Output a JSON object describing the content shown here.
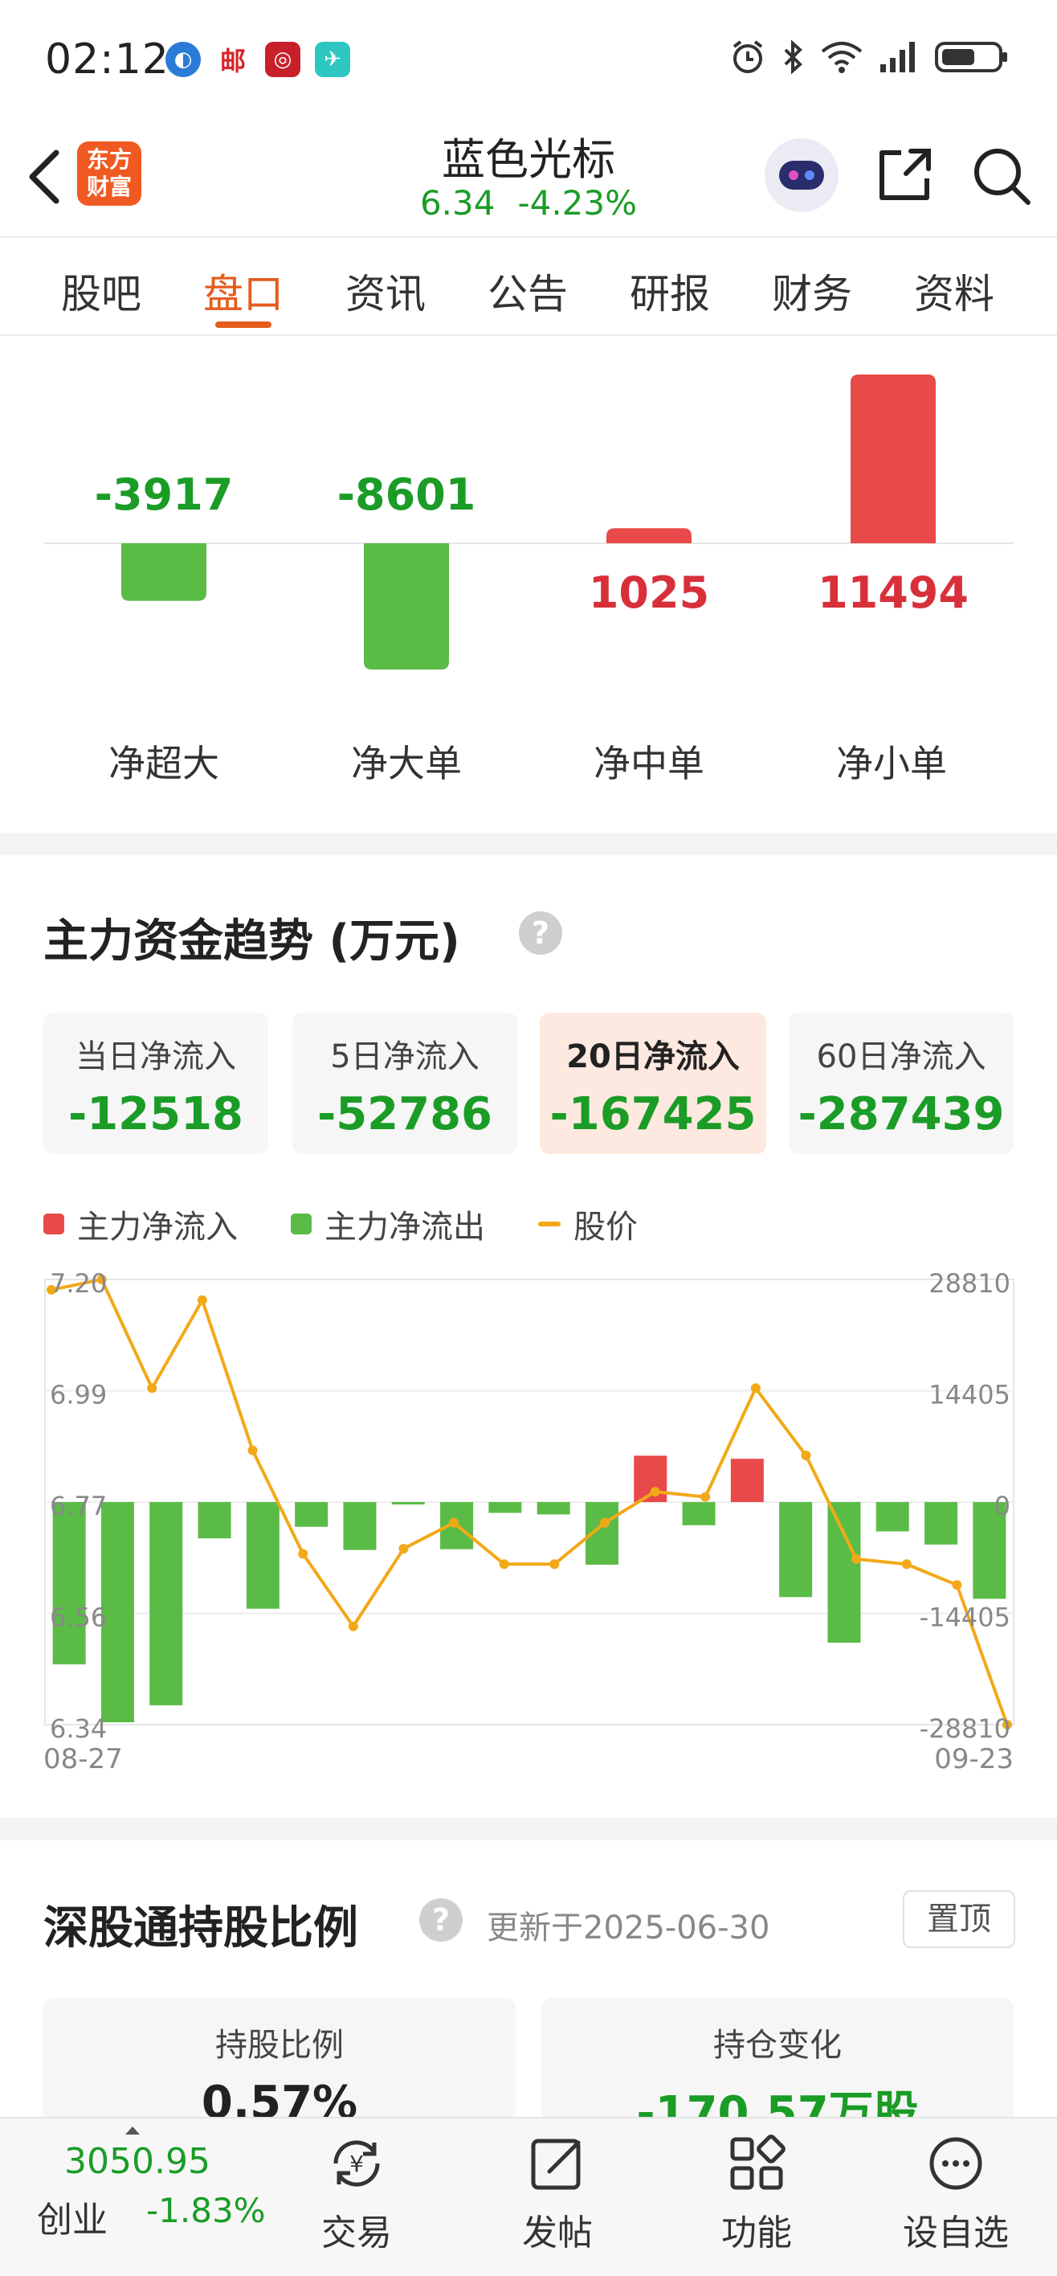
{
  "status_bar": {
    "time": "02:12"
  },
  "header": {
    "logo_text_top": "东方",
    "logo_text_bottom": "财富",
    "stock_name": "蓝色光标",
    "price": "6.34",
    "change_pct": "-4.23%"
  },
  "tabs": [
    "股吧",
    "盘口",
    "资讯",
    "公告",
    "研报",
    "财务",
    "资料"
  ],
  "active_tab": "盘口",
  "flow_bars": {
    "items": [
      {
        "label": "净超大",
        "value": -3917,
        "display": "-3917"
      },
      {
        "label": "净大单",
        "value": -8601,
        "display": "-8601"
      },
      {
        "label": "净中单",
        "value": 1025,
        "display": "1025"
      },
      {
        "label": "净小单",
        "value": 11494,
        "display": "11494"
      }
    ]
  },
  "trend": {
    "title": "主力资金趋势 (万元)",
    "help": "?",
    "cards": [
      {
        "label": "当日净流入",
        "value": "-12518"
      },
      {
        "label": "5日净流入",
        "value": "-52786"
      },
      {
        "label": "20日净流入",
        "value": "-167425"
      },
      {
        "label": "60日净流入",
        "value": "-287439"
      }
    ],
    "legend": {
      "inflow": "主力净流入",
      "outflow": "主力净流出",
      "price": "股价"
    }
  },
  "chart_data": {
    "type": "bar",
    "x_start_label": "08-27",
    "x_end_label": "09-23",
    "left_ticks": [
      "7.20",
      "6.99",
      "6.77",
      "6.56",
      "6.34"
    ],
    "right_ticks": [
      "28810",
      "14405",
      "0",
      "-14405",
      "-28810"
    ],
    "ylim_left": [
      6.34,
      7.2
    ],
    "ylim_right": [
      -28810,
      28810
    ],
    "series": [
      {
        "name": "主力净流入/主力净流出",
        "values": [
          -21000,
          -28500,
          -26300,
          -4700,
          -13800,
          -3200,
          -6200,
          -300,
          -6100,
          -1400,
          -1600,
          -8100,
          6000,
          -3000,
          5600,
          -12300,
          -18200,
          -3800,
          -5500,
          -12518
        ]
      },
      {
        "name": "股价",
        "values": [
          7.18,
          7.2,
          6.99,
          7.16,
          6.87,
          6.67,
          6.53,
          6.68,
          6.73,
          6.65,
          6.65,
          6.73,
          6.79,
          6.78,
          6.99,
          6.86,
          6.66,
          6.65,
          6.61,
          6.34
        ]
      }
    ],
    "colors": {
      "up": "#e84a4a",
      "down": "#5bbb47",
      "price": "#f2a918"
    }
  },
  "hk_connect": {
    "title": "深股通持股比例",
    "help": "?",
    "update": "更新于2025-06-30",
    "pin_label": "置顶",
    "cards": [
      {
        "label": "持股比例",
        "value": "0.57%"
      },
      {
        "label": "持仓变化",
        "value": "-170.57万股"
      }
    ]
  },
  "bottom_nav": {
    "index_value": "3050.95",
    "index_name": "创业",
    "index_change": "-1.83%",
    "items": [
      {
        "label": "交易",
        "icon": "trade-icon"
      },
      {
        "label": "发帖",
        "icon": "post-icon"
      },
      {
        "label": "功能",
        "icon": "function-icon"
      },
      {
        "label": "设自选",
        "icon": "watchlist-icon"
      }
    ]
  },
  "colors": {
    "accent": "#e55b1c",
    "up": "#e84a4a",
    "down": "#1a9c27"
  }
}
